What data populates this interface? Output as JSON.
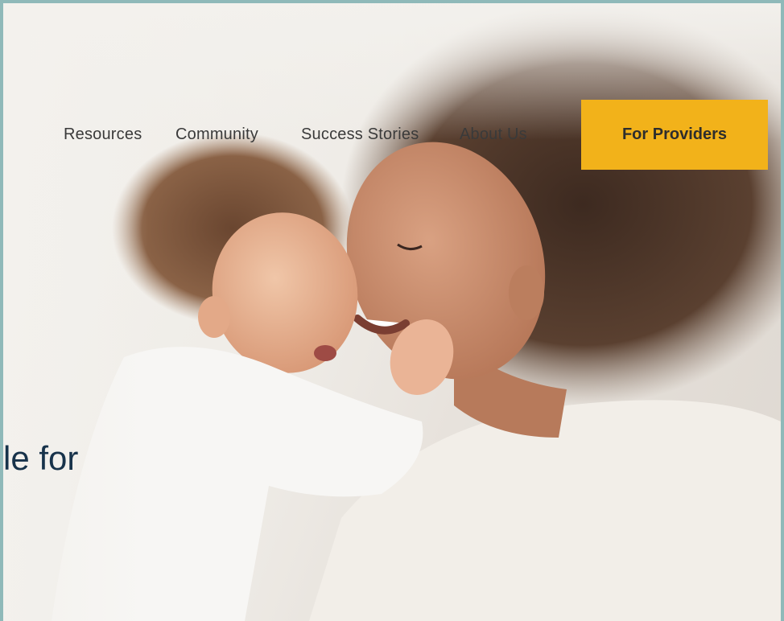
{
  "nav": {
    "items": [
      {
        "label": "Resources"
      },
      {
        "label": "Community"
      },
      {
        "label": "Success Stories"
      },
      {
        "label": "About Us"
      }
    ],
    "cta_label": "For Providers"
  },
  "hero": {
    "headline_fragment": "le for",
    "image_subject": "mother-and-baby-photo"
  },
  "colors": {
    "frame": "#8fb9b9",
    "cta": "#f2b21a",
    "headline": "#17324a",
    "nav_text": "#3a3a3a"
  }
}
